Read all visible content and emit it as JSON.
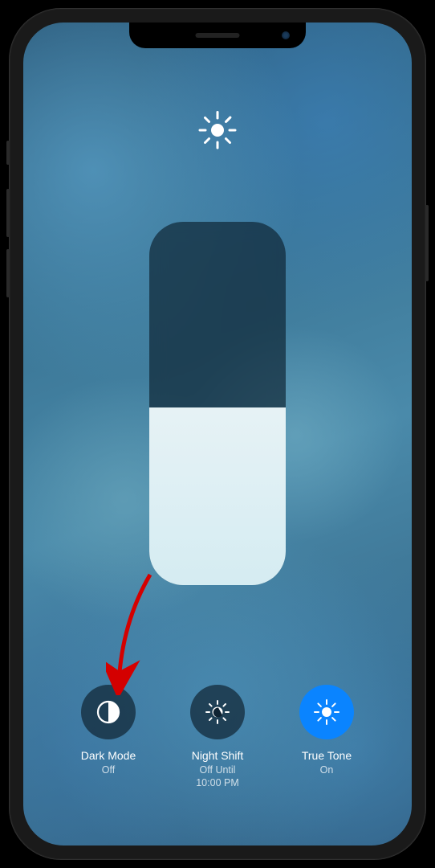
{
  "header": {
    "icon": "brightness-sun-icon"
  },
  "slider": {
    "level_percent": 49
  },
  "controls": [
    {
      "id": "dark-mode",
      "label": "Dark Mode",
      "status": "Off",
      "state": "off",
      "icon": "dark-mode-icon"
    },
    {
      "id": "night-shift",
      "label": "Night Shift",
      "status": "Off Until\n10:00 PM",
      "state": "off",
      "icon": "night-shift-icon"
    },
    {
      "id": "true-tone",
      "label": "True Tone",
      "status": "On",
      "state": "on",
      "icon": "true-tone-icon"
    }
  ],
  "annotation": {
    "type": "arrow",
    "color": "#d40000",
    "target": "dark-mode"
  }
}
